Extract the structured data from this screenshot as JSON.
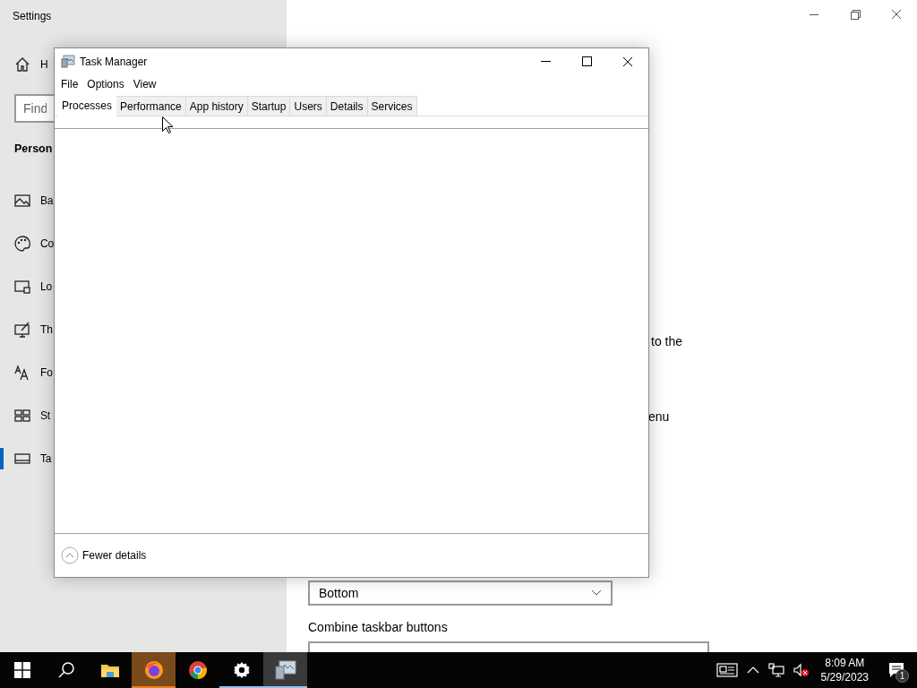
{
  "settings": {
    "title": "Settings",
    "sidebar": {
      "home": "H",
      "search": {
        "placeholder": "Find"
      },
      "heading": "Person",
      "items": [
        {
          "kind": "background",
          "label": "Ba",
          "selected": false
        },
        {
          "kind": "colors",
          "label": "Co",
          "selected": false
        },
        {
          "kind": "lock",
          "label": "Lo",
          "selected": false
        },
        {
          "kind": "themes",
          "label": "Th",
          "selected": false
        },
        {
          "kind": "fonts",
          "label": "Fo",
          "selected": false
        },
        {
          "kind": "start",
          "label": "St",
          "selected": false
        },
        {
          "kind": "taskbar",
          "label": "Ta",
          "selected": true
        }
      ]
    },
    "content": {
      "fragments": [
        "to the",
        "enu"
      ],
      "position_dropdown": {
        "value": "Bottom"
      },
      "combine_label": "Combine taskbar buttons"
    }
  },
  "task_manager": {
    "title": "Task Manager",
    "menu": [
      "File",
      "Options",
      "View"
    ],
    "tabs": [
      {
        "label": "Processes",
        "selected": true
      },
      {
        "label": "Performance",
        "selected": false
      },
      {
        "label": "App history",
        "selected": false
      },
      {
        "label": "Startup",
        "selected": false
      },
      {
        "label": "Users",
        "selected": false
      },
      {
        "label": "Details",
        "selected": false
      },
      {
        "label": "Services",
        "selected": false
      }
    ],
    "footer": "Fewer details"
  },
  "taskbar": {
    "apps": [
      {
        "kind": "start",
        "running": false,
        "selected": false,
        "hovered": false
      },
      {
        "kind": "search",
        "running": false,
        "selected": false,
        "hovered": false
      },
      {
        "kind": "explorer",
        "running": false,
        "selected": false,
        "hovered": false
      },
      {
        "kind": "firefox",
        "running": true,
        "selected": false,
        "hovered": true
      },
      {
        "kind": "chrome",
        "running": false,
        "selected": false,
        "hovered": false
      },
      {
        "kind": "settings",
        "running": true,
        "selected": false,
        "hovered": false
      },
      {
        "kind": "taskmanager",
        "running": true,
        "selected": true,
        "hovered": false
      }
    ],
    "time": "8:09 AM",
    "date": "5/29/2023",
    "notifications": "1"
  }
}
